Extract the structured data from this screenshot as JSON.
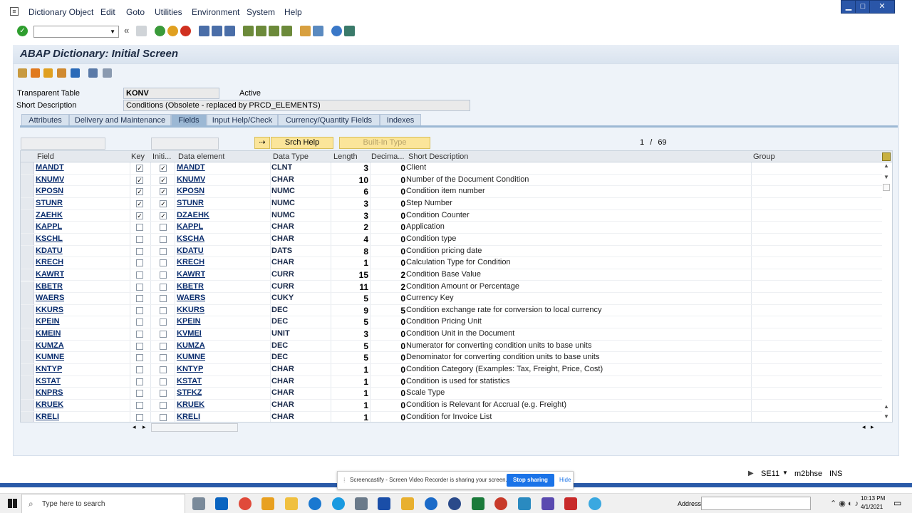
{
  "menu": [
    "Dictionary Object",
    "Edit",
    "Goto",
    "Utilities",
    "Environment",
    "System",
    "Help"
  ],
  "title": "ABAP Dictionary: Initial Screen",
  "header": {
    "table_type_label": "Transparent Table",
    "table_name": "KONV",
    "status": "Active",
    "short_desc_label": "Short Description",
    "short_desc": "Conditions (Obsolete - replaced by PRCD_ELEMENTS)"
  },
  "tabs": [
    "Attributes",
    "Delivery and Maintenance",
    "Fields",
    "Input Help/Check",
    "Currency/Quantity Fields",
    "Indexes"
  ],
  "active_tab": "Fields",
  "buttons": {
    "srch_help": "Srch Help",
    "builtin_type": "Built-In Type"
  },
  "pager": {
    "current": "1",
    "sep": "/",
    "total": "69"
  },
  "columns": [
    "Field",
    "Key",
    "Initi...",
    "Data element",
    "Data Type",
    "Length",
    "Decima...",
    "Short Description",
    "Group"
  ],
  "rows": [
    {
      "field": "MANDT",
      "key": true,
      "init": true,
      "elem": "MANDT",
      "type": "CLNT",
      "len": "3",
      "dec": "0",
      "desc": "Client"
    },
    {
      "field": "KNUMV",
      "key": true,
      "init": true,
      "elem": "KNUMV",
      "type": "CHAR",
      "len": "10",
      "dec": "0",
      "desc": "Number of the Document Condition"
    },
    {
      "field": "KPOSN",
      "key": true,
      "init": true,
      "elem": "KPOSN",
      "type": "NUMC",
      "len": "6",
      "dec": "0",
      "desc": "Condition item number"
    },
    {
      "field": "STUNR",
      "key": true,
      "init": true,
      "elem": "STUNR",
      "type": "NUMC",
      "len": "3",
      "dec": "0",
      "desc": "Step Number"
    },
    {
      "field": "ZAEHK",
      "key": true,
      "init": true,
      "elem": "DZAEHK",
      "type": "NUMC",
      "len": "3",
      "dec": "0",
      "desc": "Condition Counter"
    },
    {
      "field": "KAPPL",
      "key": false,
      "init": false,
      "elem": "KAPPL",
      "type": "CHAR",
      "len": "2",
      "dec": "0",
      "desc": "Application"
    },
    {
      "field": "KSCHL",
      "key": false,
      "init": false,
      "elem": "KSCHA",
      "type": "CHAR",
      "len": "4",
      "dec": "0",
      "desc": "Condition type"
    },
    {
      "field": "KDATU",
      "key": false,
      "init": false,
      "elem": "KDATU",
      "type": "DATS",
      "len": "8",
      "dec": "0",
      "desc": "Condition pricing date"
    },
    {
      "field": "KRECH",
      "key": false,
      "init": false,
      "elem": "KRECH",
      "type": "CHAR",
      "len": "1",
      "dec": "0",
      "desc": "Calculation Type for Condition"
    },
    {
      "field": "KAWRT",
      "key": false,
      "init": false,
      "elem": "KAWRT",
      "type": "CURR",
      "len": "15",
      "dec": "2",
      "desc": "Condition Base Value"
    },
    {
      "field": "KBETR",
      "key": false,
      "init": false,
      "elem": "KBETR",
      "type": "CURR",
      "len": "11",
      "dec": "2",
      "desc": "Condition Amount or Percentage"
    },
    {
      "field": "WAERS",
      "key": false,
      "init": false,
      "elem": "WAERS",
      "type": "CUKY",
      "len": "5",
      "dec": "0",
      "desc": "Currency Key"
    },
    {
      "field": "KKURS",
      "key": false,
      "init": false,
      "elem": "KKURS",
      "type": "DEC",
      "len": "9",
      "dec": "5",
      "desc": "Condition exchange rate for conversion to local currency"
    },
    {
      "field": "KPEIN",
      "key": false,
      "init": false,
      "elem": "KPEIN",
      "type": "DEC",
      "len": "5",
      "dec": "0",
      "desc": "Condition Pricing Unit"
    },
    {
      "field": "KMEIN",
      "key": false,
      "init": false,
      "elem": "KVMEI",
      "type": "UNIT",
      "len": "3",
      "dec": "0",
      "desc": "Condition Unit in the Document"
    },
    {
      "field": "KUMZA",
      "key": false,
      "init": false,
      "elem": "KUMZA",
      "type": "DEC",
      "len": "5",
      "dec": "0",
      "desc": "Numerator for converting condition units to base units"
    },
    {
      "field": "KUMNE",
      "key": false,
      "init": false,
      "elem": "KUMNE",
      "type": "DEC",
      "len": "5",
      "dec": "0",
      "desc": "Denominator for converting condition units to base units"
    },
    {
      "field": "KNTYP",
      "key": false,
      "init": false,
      "elem": "KNTYP",
      "type": "CHAR",
      "len": "1",
      "dec": "0",
      "desc": "Condition Category (Examples: Tax, Freight, Price, Cost)"
    },
    {
      "field": "KSTAT",
      "key": false,
      "init": false,
      "elem": "KSTAT",
      "type": "CHAR",
      "len": "1",
      "dec": "0",
      "desc": "Condition is used for statistics"
    },
    {
      "field": "KNPRS",
      "key": false,
      "init": false,
      "elem": "STFKZ",
      "type": "CHAR",
      "len": "1",
      "dec": "0",
      "desc": "Scale Type"
    },
    {
      "field": "KRUEK",
      "key": false,
      "init": false,
      "elem": "KRUEK",
      "type": "CHAR",
      "len": "1",
      "dec": "0",
      "desc": "Condition is Relevant for Accrual  (e.g. Freight)"
    },
    {
      "field": "KRELI",
      "key": false,
      "init": false,
      "elem": "KRELI",
      "type": "CHAR",
      "len": "1",
      "dec": "0",
      "desc": "Condition for Invoice List"
    }
  ],
  "statusbar": {
    "tcode": "SE11",
    "server": "m2bhse",
    "mode": "INS"
  },
  "share_bar": {
    "text": "Screencastify - Screen Video Recorder is sharing your screen.",
    "stop": "Stop sharing",
    "hide": "Hide"
  },
  "taskbar": {
    "search": "Type here to search",
    "address": "Address",
    "time": "10:13 PM",
    "date": "4/1/2021"
  },
  "colors": {
    "accent": "#2a5aa8",
    "link": "#0a2d6e",
    "yellow_btn": "#fbe59a"
  }
}
